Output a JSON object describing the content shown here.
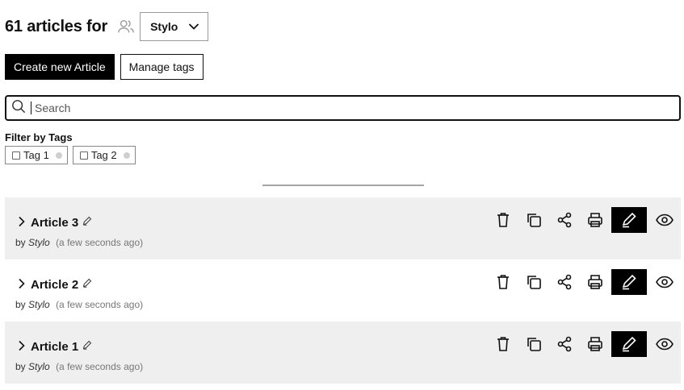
{
  "header": {
    "title": "61 articles for",
    "workspace": "Stylo"
  },
  "actions": {
    "create_label": "Create new Article",
    "tags_label": "Manage tags"
  },
  "search": {
    "placeholder": "Search",
    "value": ""
  },
  "filters": {
    "label": "Filter by Tags",
    "tags": [
      {
        "label": "Tag 1",
        "checked": false
      },
      {
        "label": "Tag 2",
        "checked": false
      }
    ]
  },
  "articles": [
    {
      "title": "Article 3",
      "by": "by",
      "author": "Stylo",
      "time": "(a few seconds ago)"
    },
    {
      "title": "Article 2",
      "by": "by",
      "author": "Stylo",
      "time": "(a few seconds ago)"
    },
    {
      "title": "Article 1",
      "by": "by",
      "author": "Stylo",
      "time": "(a few seconds ago)"
    }
  ],
  "icons": {
    "users": "users-icon",
    "chevron": "chevron-down-icon",
    "search": "search-icon",
    "delete": "trash-icon",
    "duplicate": "copy-icon",
    "share": "share-icon",
    "print": "printer-icon",
    "edit": "pencil-icon",
    "preview": "eye-icon"
  },
  "colors": {
    "primary": "#000000",
    "row_bg": "#efefef",
    "muted": "#777777"
  }
}
